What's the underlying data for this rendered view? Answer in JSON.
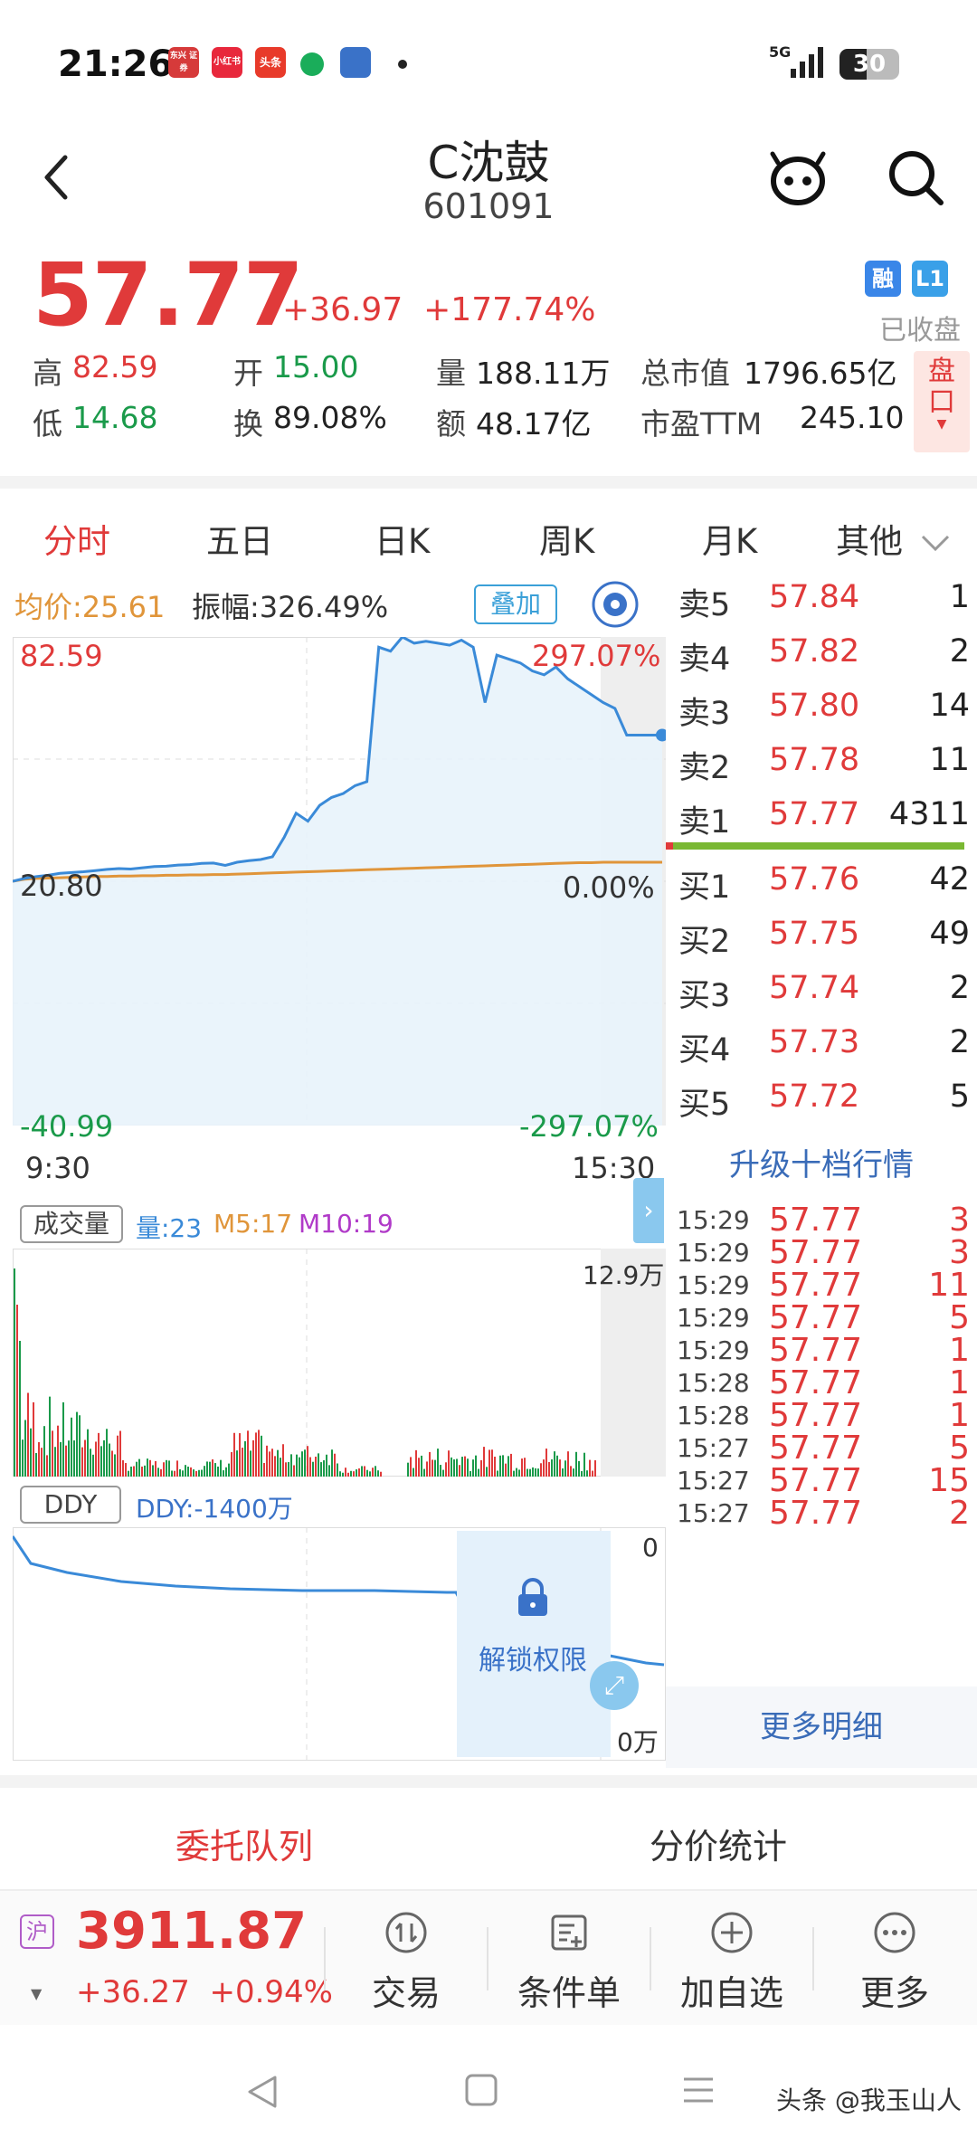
{
  "status_bar": {
    "time": "21:26",
    "apps": [
      {
        "name": "东兴\n证券",
        "color": "#d63a3a"
      },
      {
        "name": "小红书",
        "color": "#e8283c"
      },
      {
        "name": "头条",
        "color": "#e83a2a"
      },
      {
        "name": "",
        "color": "#1aad5a"
      },
      {
        "name": "",
        "color": "#3a72c8"
      }
    ],
    "signal": "5G",
    "battery": "30"
  },
  "header": {
    "title": "C沈鼓",
    "code": "601091"
  },
  "quote": {
    "price": "57.77",
    "change": "+36.97",
    "change_pct": "+177.74%",
    "badge_rong": "融",
    "badge_l1": "L1",
    "status": "已收盘",
    "high_label": "高",
    "high": "82.59",
    "open_label": "开",
    "open": "15.00",
    "volume_label": "量",
    "volume": "188.11万",
    "mktcap_label": "总市值",
    "mktcap": "1796.65亿",
    "low_label": "低",
    "low": "14.68",
    "turnover_label": "换",
    "turnover": "89.08%",
    "amount_label": "额",
    "amount": "48.17亿",
    "pe_label": "市盈TTM",
    "pe": "245.10",
    "pankou": "盘口"
  },
  "tabs": [
    {
      "label": "分时",
      "active": true
    },
    {
      "label": "五日",
      "active": false
    },
    {
      "label": "日K",
      "active": false
    },
    {
      "label": "周K",
      "active": false
    },
    {
      "label": "月K",
      "active": false
    },
    {
      "label": "其他",
      "active": false
    }
  ],
  "chart": {
    "avg_label": "均价:25.61",
    "amp_label": "振幅:326.49%",
    "overlay_label": "叠加",
    "price_top": "82.59",
    "pct_top": "297.07%",
    "price_mid": "20.80",
    "pct_mid": "0.00%",
    "price_bottom": "-40.99",
    "pct_bottom": "-297.07%",
    "time_start": "9:30",
    "time_end": "15:30",
    "vol_tag": "成交量",
    "vol_now": "量:23",
    "vol_m5": "M5:17",
    "vol_m10": "M10:19",
    "vol_max": "12.9万",
    "ddy_tag": "DDY",
    "ddy_value": "DDY:-1400万",
    "ddy_top": "0",
    "ddy_bottom": "0万",
    "unlock_label": "解锁权限"
  },
  "chart_data": {
    "type": "line",
    "series": [
      {
        "values": [
          20.8,
          21.5,
          22.0,
          22.3,
          22.8,
          23.0,
          23.2,
          23.5,
          23.8,
          24.0,
          23.9,
          24.2,
          24.5,
          24.6,
          24.9,
          25.0,
          25.3,
          25.4,
          24.8,
          25.6,
          26.0,
          26.3,
          27.0,
          32.0,
          38.0,
          36.0,
          40.0,
          42.0,
          43.0,
          45.0,
          46.0,
          80.0,
          79.0,
          82.59,
          81.0,
          81.5,
          81.0,
          80.5,
          81.8,
          80.0,
          66.0,
          78.0,
          77.0,
          76.0,
          74.0,
          73.0,
          75.0,
          72.0,
          70.0,
          68.0,
          66.0,
          64.5,
          57.77,
          57.77,
          57.77,
          57.77
        ]
      },
      {
        "values": [
          20.8,
          21.3,
          21.5,
          21.6,
          21.7,
          21.8,
          21.9,
          22.0,
          22.0,
          22.1,
          22.1,
          22.2,
          22.2,
          22.3,
          22.3,
          22.4,
          22.4,
          22.5,
          22.5,
          22.6,
          22.7,
          22.8,
          22.9,
          23.0,
          23.1,
          23.2,
          23.3,
          23.4,
          23.5,
          23.6,
          23.7,
          23.8,
          23.9,
          24.0,
          24.1,
          24.2,
          24.3,
          24.4,
          24.5,
          24.6,
          24.7,
          24.8,
          24.9,
          25.0,
          25.1,
          25.2,
          25.3,
          25.4,
          25.5,
          25.5,
          25.6,
          25.6,
          25.61,
          25.61,
          25.61,
          25.61
        ]
      }
    ],
    "ylim": [
      -40.99,
      82.59
    ],
    "xlabel": "",
    "ylabel": ""
  },
  "order_book": {
    "asks": [
      {
        "label": "卖5",
        "price": "57.84",
        "vol": "1"
      },
      {
        "label": "卖4",
        "price": "57.82",
        "vol": "2"
      },
      {
        "label": "卖3",
        "price": "57.80",
        "vol": "14"
      },
      {
        "label": "卖2",
        "price": "57.78",
        "vol": "11"
      },
      {
        "label": "卖1",
        "price": "57.77",
        "vol": "4311"
      }
    ],
    "bids": [
      {
        "label": "买1",
        "price": "57.76",
        "vol": "42"
      },
      {
        "label": "买2",
        "price": "57.75",
        "vol": "49"
      },
      {
        "label": "买3",
        "price": "57.74",
        "vol": "2"
      },
      {
        "label": "买4",
        "price": "57.73",
        "vol": "2"
      },
      {
        "label": "买5",
        "price": "57.72",
        "vol": "5"
      }
    ],
    "upgrade_label": "升级十档行情",
    "ticks": [
      {
        "time": "15:29",
        "price": "57.77",
        "vol": "3"
      },
      {
        "time": "15:29",
        "price": "57.77",
        "vol": "3"
      },
      {
        "time": "15:29",
        "price": "57.77",
        "vol": "11"
      },
      {
        "time": "15:29",
        "price": "57.77",
        "vol": "5"
      },
      {
        "time": "15:29",
        "price": "57.77",
        "vol": "1"
      },
      {
        "time": "15:28",
        "price": "57.77",
        "vol": "1"
      },
      {
        "time": "15:28",
        "price": "57.77",
        "vol": "1"
      },
      {
        "time": "15:27",
        "price": "57.77",
        "vol": "5"
      },
      {
        "time": "15:27",
        "price": "57.77",
        "vol": "15"
      },
      {
        "time": "15:27",
        "price": "57.77",
        "vol": "2"
      }
    ],
    "more_label": "更多明细"
  },
  "bottom_tabs": [
    {
      "label": "委托队列",
      "active": true
    },
    {
      "label": "分价统计",
      "active": false
    }
  ],
  "footer": {
    "index_badge": "沪",
    "index_value": "3911.87",
    "index_change": "+36.27",
    "index_change_pct": "+0.94%",
    "buttons": [
      {
        "label": "交易",
        "icon": "trade-icon"
      },
      {
        "label": "条件单",
        "icon": "condition-order-icon"
      },
      {
        "label": "加自选",
        "icon": "add-icon"
      },
      {
        "label": "更多",
        "icon": "more-icon"
      }
    ]
  },
  "watermark": "头条 @我玉山人"
}
